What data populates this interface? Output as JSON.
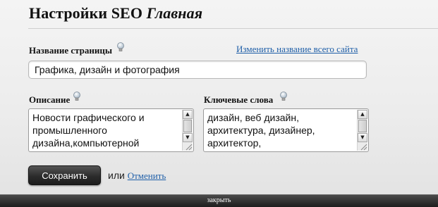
{
  "header": {
    "title": "Настройки SEO",
    "subtitle": "Главная"
  },
  "page_name": {
    "label": "Название страницы",
    "change_site_name_link": "Изменить название всего сайта",
    "value": "Графика, дизайн и фотография"
  },
  "description": {
    "label": "Описание",
    "value": "Новости графического и\nпромышленного\nдизайна,компьютерной"
  },
  "keywords": {
    "label": "Ключевые слова",
    "value": "дизайн, веб дизайн,\nархитектура, дизайнер,\nархитектор,"
  },
  "actions": {
    "save_label": "Сохранить",
    "or_text": "или",
    "cancel_label": "Отменить"
  },
  "footer": {
    "close_label": "закрыть"
  },
  "icons": {
    "hint": "lightbulb-icon",
    "scroll_up": "arrow-up-icon",
    "scroll_down": "arrow-down-icon",
    "resize": "resize-grip-icon"
  },
  "colors": {
    "link": "#1f5fa8",
    "button_bg": "#2c2c2c",
    "footer_bg": "#1d1d1d"
  }
}
